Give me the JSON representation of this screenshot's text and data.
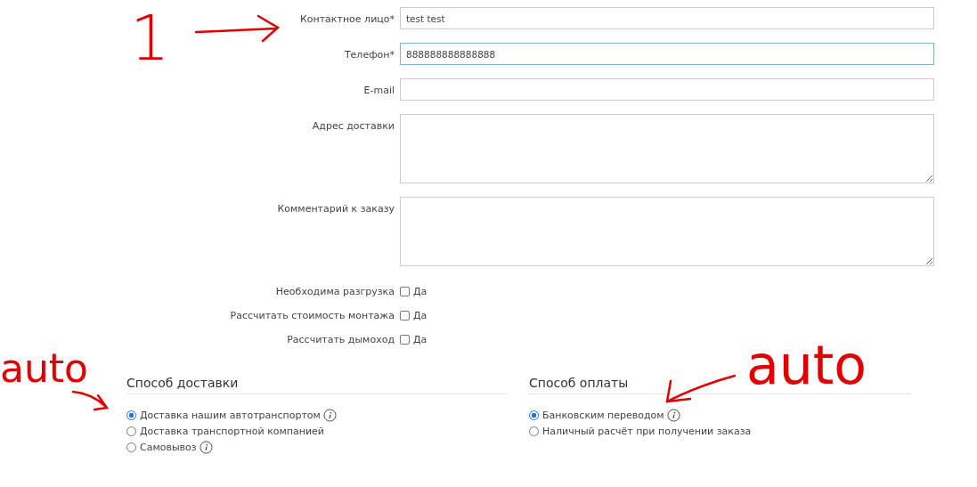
{
  "fields": [
    {
      "label": "Контактное лицо*",
      "kind": "input",
      "value": "test test",
      "focused": false
    },
    {
      "label": "Телефон*",
      "kind": "input",
      "value": "888888888888888",
      "focused": true
    },
    {
      "label": "E-mail",
      "kind": "input",
      "focused": false
    },
    {
      "label": "Адрес доставки",
      "kind": "textarea",
      "focused": false
    },
    {
      "label": "Комментарий к заказу",
      "kind": "textarea",
      "focused": false
    }
  ],
  "checkboxes": [
    {
      "label": "Необходима разгрузка",
      "option": "Да",
      "checked": false
    },
    {
      "label": "Рассчитать стоимость монтажа",
      "option": "Да",
      "checked": false
    },
    {
      "label": "Рассчитать дымоход",
      "option": "Да",
      "checked": false
    }
  ],
  "sections": [
    {
      "title": "Способ доставки",
      "options": [
        {
          "label": "Доставка нашим автотранспортом",
          "selected": true,
          "info": true
        },
        {
          "label": "Доставка транспортной компанией",
          "selected": false,
          "info": false
        },
        {
          "label": "Самовывоз",
          "selected": false,
          "info": true
        }
      ]
    },
    {
      "title": "Способ оплаты",
      "options": [
        {
          "label": "Банковским переводом",
          "selected": true,
          "info": true
        },
        {
          "label": "Наличный расчёт при получении заказа",
          "selected": false,
          "info": false
        }
      ]
    }
  ],
  "annotations": [
    {
      "text": "1"
    },
    {
      "text": "auto"
    },
    {
      "text": "auto"
    }
  ]
}
